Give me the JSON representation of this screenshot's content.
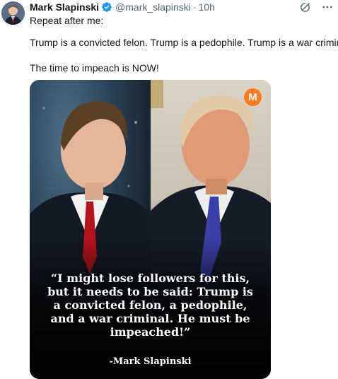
{
  "post": {
    "author_name": "Mark Slapinski",
    "handle": "@mark_slapinski",
    "separator": "·",
    "time": "10h",
    "lines": [
      "Repeat after me:",
      "Trump is a convicted felon. Trump is a pedophile. Trump is a war criminal.",
      "The time to impeach is NOW!"
    ]
  },
  "media": {
    "logo_letter": "M",
    "quote_lines": [
      "“I might lose followers for this,",
      "but it needs to be said: Trump is",
      "a convicted felon, a pedophile,",
      "and a war criminal. He must be",
      "impeached!”"
    ],
    "attribution": "-Mark Slapinski"
  },
  "icons": {
    "verified": "verified-badge-icon",
    "grok": "grok-icon",
    "more": "more-icon"
  },
  "colors": {
    "verified": "#1d9bf0",
    "logo": "#ff7a1a",
    "secondary_text": "#536471"
  }
}
